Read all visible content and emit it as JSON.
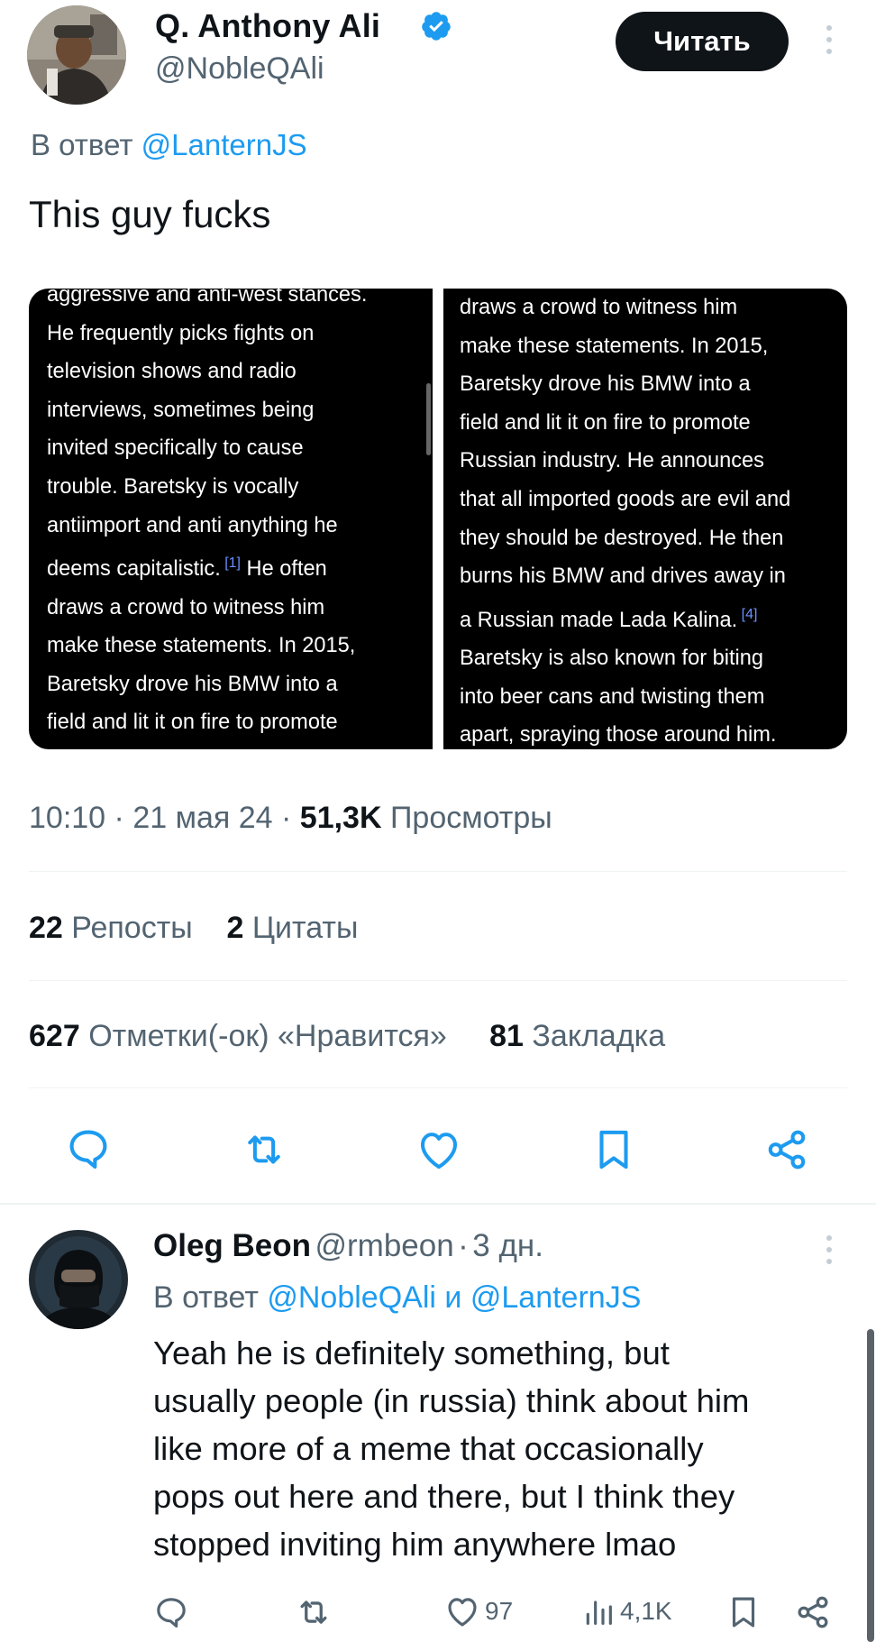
{
  "tweet": {
    "author_name": "Q. Anthony Ali",
    "author_handle": "@NobleQAli",
    "follow_label": "Читать",
    "reply_prefix": "В ответ",
    "reply_to": "@LanternJS",
    "text": "This guy fucks",
    "image_left_lines": [
      "aggressive and anti-west stances.",
      "He frequently picks fights on",
      "television shows and radio",
      "interviews, sometimes being",
      "invited specifically to cause",
      "trouble. Baretsky is vocally",
      "antiimport and anti anything he",
      "deems capitalistic.",
      "draws a crowd to witness him",
      "make these statements. In 2015,",
      "Baretsky drove his BMW into a",
      "field and lit it on fire to promote"
    ],
    "image_left_ref": "[1]",
    "image_left_ref_tail": " He often",
    "image_right_lines": [
      "draws a crowd to witness him",
      "make these statements. In 2015,",
      "Baretsky drove his BMW into a",
      "field and lit it on fire to promote",
      "Russian industry. He announces",
      "that all imported goods are evil and",
      "they should be destroyed. He then",
      "burns his BMW and drives away in",
      "a Russian made Lada Kalina.",
      "Baretsky is also known for biting",
      "into beer cans and twisting them",
      "apart, spraying those around him."
    ],
    "image_right_ref": "[4]",
    "time": "10:10",
    "date": "21 мая 24",
    "views_count": "51,3K",
    "views_label": "Просмотры",
    "reposts_count": "22",
    "reposts_label": "Репосты",
    "quotes_count": "2",
    "quotes_label": "Цитаты",
    "likes_count": "627",
    "likes_label": "Отметки(-ок) «Нравится»",
    "bookmarks_count": "81",
    "bookmarks_label": "Закладка",
    "actions": [
      "reply-icon",
      "repost-icon",
      "like-icon",
      "bookmark-icon",
      "share-icon"
    ]
  },
  "reply": {
    "author_name": "Oleg Beon",
    "author_handle": "@rmbeon",
    "separator": "·",
    "age": "3 дн.",
    "reply_prefix": "В ответ",
    "reply_to_1": "@NobleQAli",
    "conjunction": "и",
    "reply_to_2": "@LanternJS",
    "text_lines": [
      "Yeah he is definitely something, but",
      "usually people (in russia) think about him",
      "like more of a meme that occasionally",
      "pops out here and there, but I think they",
      "stopped inviting him anywhere lmao"
    ],
    "likes": "97",
    "views": "4,1K"
  },
  "colors": {
    "accent": "#1d9bf0",
    "text": "#0f1419",
    "muted": "#536471",
    "divider": "#eff3f4"
  }
}
